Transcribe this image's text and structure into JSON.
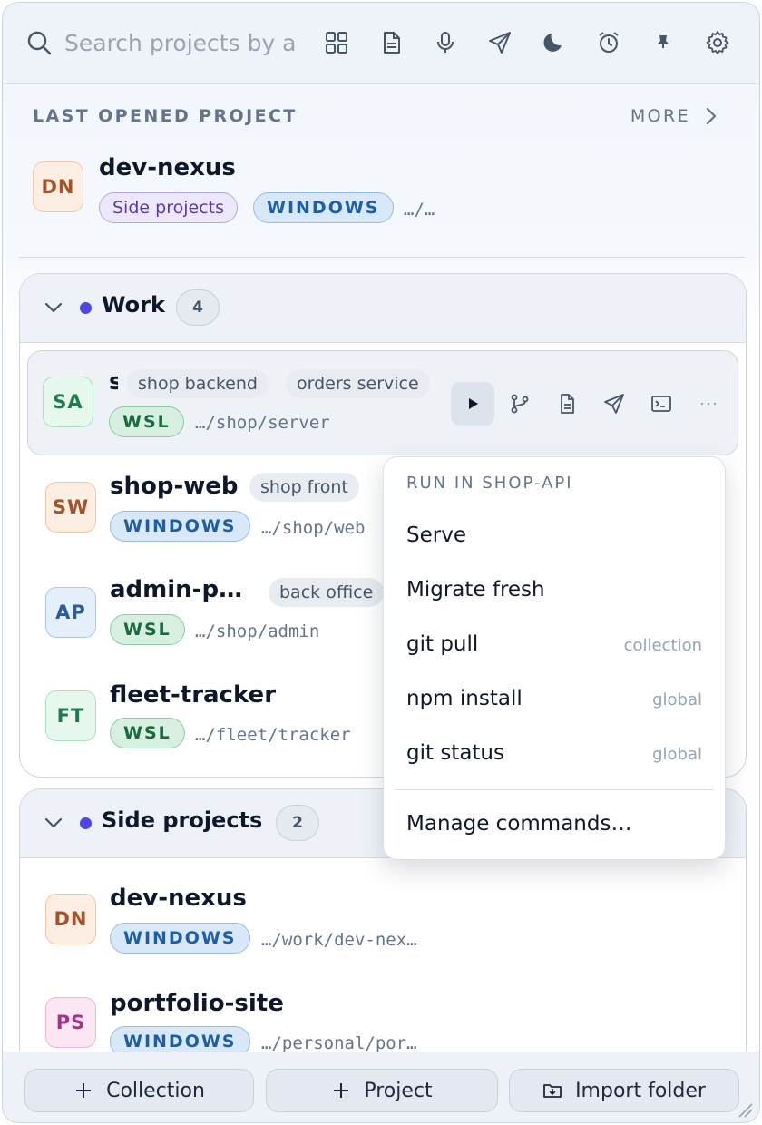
{
  "search": {
    "placeholder": "Search projects by a"
  },
  "toolbar_icons": [
    "grid-icon",
    "document-icon",
    "microphone-icon",
    "send-icon",
    "moon-icon",
    "alarm-icon",
    "pin-icon",
    "settings-icon"
  ],
  "last_opened": {
    "label": "LAST OPENED PROJECT",
    "more": "MORE",
    "project": {
      "initials": "DN",
      "name": "dev-nexus",
      "collection": "Side projects",
      "env": "WINDOWS",
      "path": "…/…"
    }
  },
  "groups": [
    {
      "title": "Work",
      "count": "4",
      "dot_color": "#4f46e5",
      "projects": [
        {
          "initials": "SA",
          "name": "s",
          "tags": [
            "shop backend",
            "orders service"
          ],
          "env": "WSL",
          "path": "…/shop/server"
        },
        {
          "initials": "SW",
          "name": "shop-web",
          "tags": [
            "shop front"
          ],
          "env": "WINDOWS",
          "path": "…/shop/web"
        },
        {
          "initials": "AP",
          "name": "admin-p…",
          "tags": [
            "back office"
          ],
          "env": "WSL",
          "path": "…/shop/admin"
        },
        {
          "initials": "FT",
          "name": "fleet-tracker",
          "tags": [],
          "env": "WSL",
          "path": "…/fleet/tracker"
        }
      ]
    },
    {
      "title": "Side projects",
      "count": "2",
      "dot_color": "#4f46e5",
      "projects": [
        {
          "initials": "DN",
          "name": "dev-nexus",
          "env": "WINDOWS",
          "path": "…/work/dev-nex…"
        },
        {
          "initials": "PS",
          "name": "portfolio-site",
          "env": "WINDOWS",
          "path": "…/personal/por…"
        }
      ]
    }
  ],
  "run_menu": {
    "title": "RUN IN SHOP-API",
    "items": [
      {
        "label": "Serve",
        "scope": ""
      },
      {
        "label": "Migrate fresh",
        "scope": ""
      },
      {
        "label": "git pull",
        "scope": "collection"
      },
      {
        "label": "npm install",
        "scope": "global"
      },
      {
        "label": "git status",
        "scope": "global"
      }
    ],
    "manage": "Manage commands…"
  },
  "footer": {
    "collection": "Collection",
    "project": "Project",
    "import": "Import folder"
  }
}
